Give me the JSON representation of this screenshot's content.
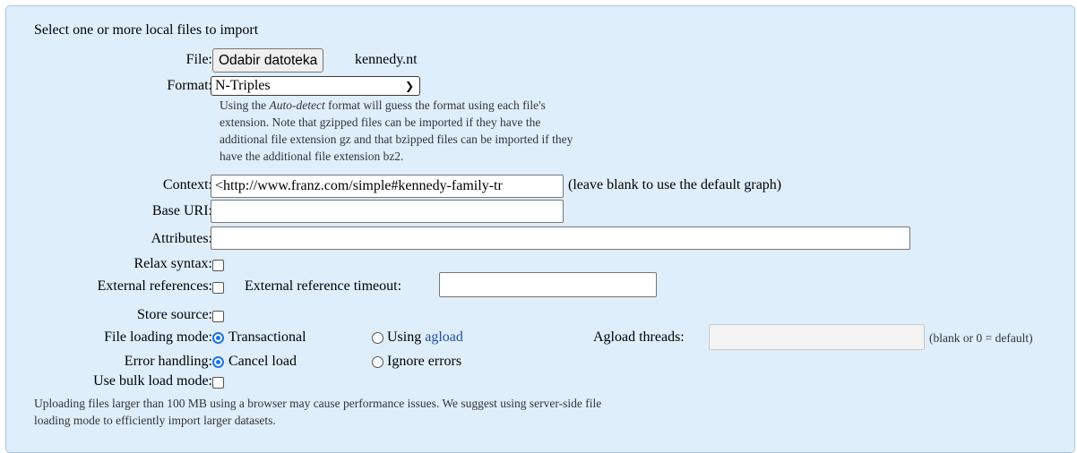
{
  "header": {
    "title": "Select one or more local files to import"
  },
  "file": {
    "label": "File:",
    "button_label": "Odabir datoteka",
    "filename": "kennedy.nt"
  },
  "format": {
    "label": "Format:",
    "selected": "N-Triples",
    "note_before": "Using the ",
    "note_emph": "Auto-detect",
    "note_line1_after": " format will guess the format using each file's",
    "note_line2": "extension. Note that gzipped files can be imported if they have the",
    "note_line3": "additional file extension gz and that bzipped files can be imported if they",
    "note_line4": "have the additional file extension bz2."
  },
  "context": {
    "label": "Context:",
    "value": "<http://www.franz.com/simple#kennedy-family-tr",
    "hint": "(leave blank to use the default graph)"
  },
  "base_uri": {
    "label": "Base URI:",
    "value": ""
  },
  "attributes": {
    "label": "Attributes:",
    "value": ""
  },
  "relax_syntax": {
    "label": "Relax syntax:",
    "checked": false
  },
  "external_references": {
    "label": "External references:",
    "checked": false
  },
  "external_timeout": {
    "label": "External reference timeout:",
    "value": ""
  },
  "store_source": {
    "label": "Store source:",
    "checked": false
  },
  "loading_mode": {
    "label": "File loading mode:",
    "option_transactional": "Transactional",
    "option_using": "Using ",
    "option_agload": "agload",
    "selected": "Transactional"
  },
  "agload_threads": {
    "label": "Agload threads:",
    "value": "",
    "hint": "(blank or 0 = default)"
  },
  "error_handling": {
    "label": "Error handling:",
    "option_cancel": "Cancel load",
    "option_ignore": "Ignore errors",
    "selected": "Cancel load"
  },
  "bulk_load": {
    "label": "Use bulk load mode:",
    "checked": false
  },
  "footer": {
    "line1": "Uploading files larger than 100 MB using a browser may cause performance issues. We suggest using server-side file",
    "line2": "loading mode to efficiently import larger datasets."
  },
  "colors": {
    "panel_bg": "#dfeefb",
    "panel_border": "#a9c6e4",
    "accent": "#1a73e8",
    "link": "#1a4f9c"
  }
}
